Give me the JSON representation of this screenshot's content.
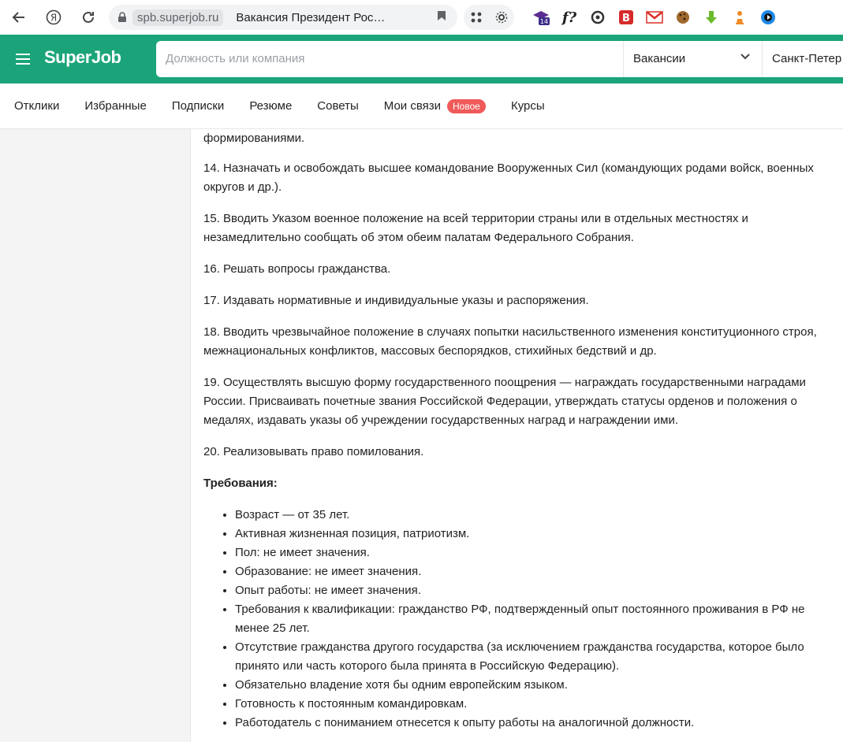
{
  "browser": {
    "domain": "spb.superjob.ru",
    "tab_title": "Вакансия Президент Рос…",
    "extensions": [
      "14",
      "f?",
      "◎",
      "B",
      "M",
      "🍪",
      "⬇",
      "♟",
      "▶"
    ]
  },
  "header": {
    "logo": "SuperJob",
    "search_placeholder": "Должность или компания",
    "search_type": "Вакансии",
    "city": "Санкт-Петер"
  },
  "subnav": {
    "items": [
      "Отклики",
      "Избранные",
      "Подписки",
      "Резюме",
      "Советы",
      "Мои связи",
      "Курсы"
    ],
    "badge": "Новое"
  },
  "content": {
    "p0": "формированиями.",
    "p14": "14. Назначать и освобождать высшее командование Вооруженных Сил (командующих родами войск, военных округов и др.).",
    "p15": "15. Вводить Указом военное положение на всей территории страны или в отдельных местностях и незамедлительно сообщать об этом обеим палатам Федерального Собрания.",
    "p16": "16. Решать вопросы гражданства.",
    "p17": "17. Издавать нормативные и индивидуальные указы и распоряжения.",
    "p18": "18. Вводить чрезвычайное положение в случаях попытки насильственного изменения конституционного строя, межнациональных конфликтов, массовых беспорядков, стихийных бедствий и др.",
    "p19": "19. Осуществлять высшую форму государственного поощрения — награждать государственными наградами России. Присваивать почетные звания Российской Федерации, утверждать статусы орденов и положения о медалях, издавать указы об учреждении государственных наград и награждении ими.",
    "p20": "20. Реализовывать право помилования.",
    "req_title": "Требования:",
    "requirements": [
      "Возраст — от 35 лет.",
      "Активная жизненная позиция, патриотизм.",
      "Пол: не имеет значения.",
      "Образование: не имеет значения.",
      "Опыт работы: не имеет значения.",
      "Требования к квалификации: гражданство РФ, подтвержденный опыт постоянного проживания в РФ не менее 25 лет.",
      "Отсутствие гражданства другого государства (за исключением гражданства государства, которое было принято или часть которого была принята в Российскую Федерацию).",
      "Обязательно владение хотя бы одним европейским языком.",
      "Готовность к постоянным командировкам.",
      "Работодатель с пониманием отнесется к опыту работы на аналогичной должности."
    ]
  }
}
